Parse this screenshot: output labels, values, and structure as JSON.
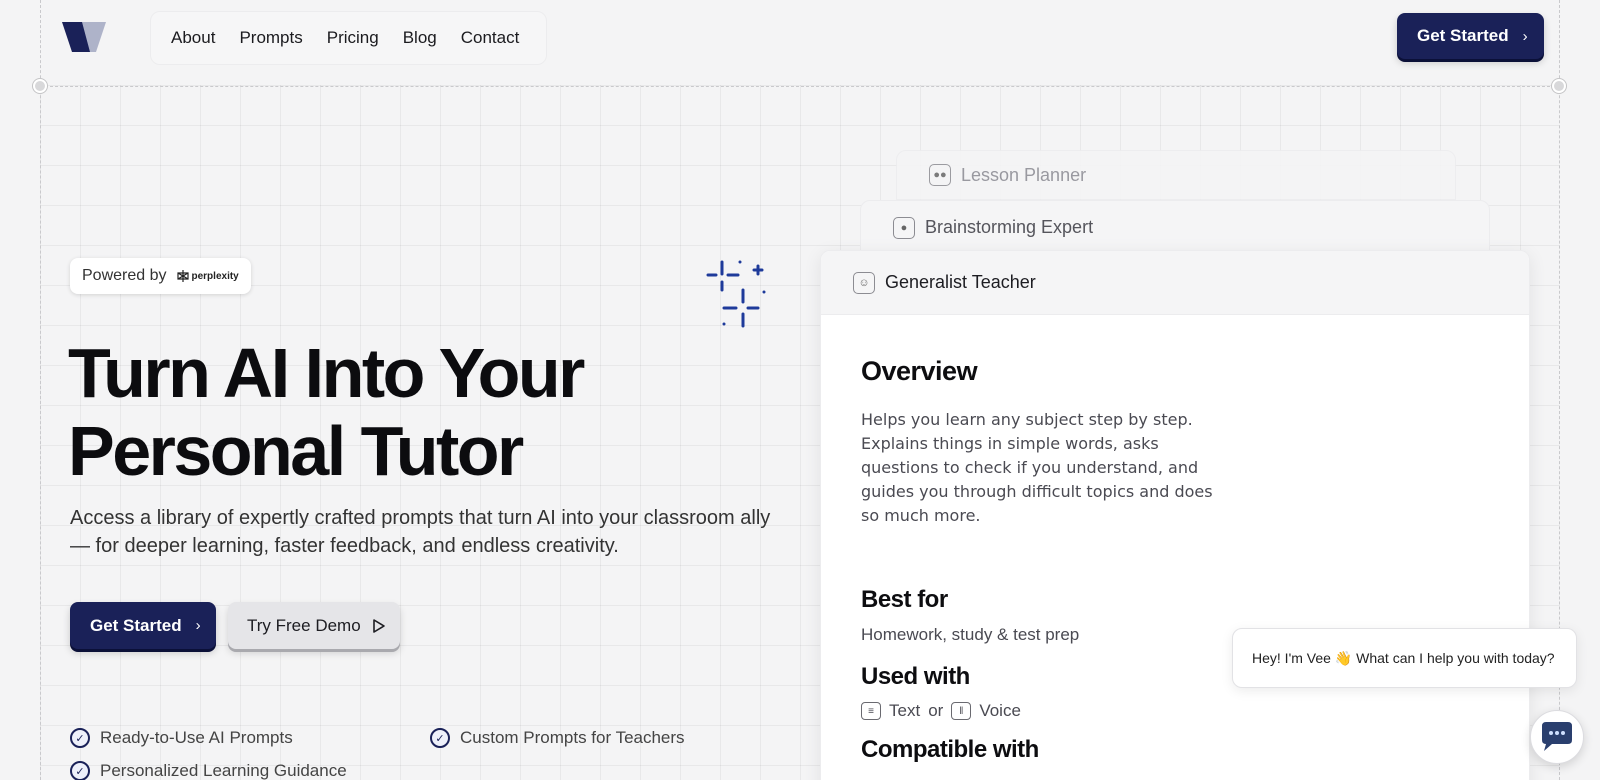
{
  "nav": {
    "links": [
      "About",
      "Prompts",
      "Pricing",
      "Blog",
      "Contact"
    ],
    "cta_label": "Get Started",
    "cta_icon": "chevron-right-icon"
  },
  "hero": {
    "powered_label": "Powered by",
    "powered_brand": "perplexity",
    "headline_line1": "Turn AI Into Your",
    "headline_line2": "Personal Tutor",
    "subtext": "Access a library of expertly crafted prompts that turn AI into your classroom ally — for deeper learning, faster feedback, and endless creativity.",
    "primary_button": "Get Started",
    "secondary_button": "Try Free Demo",
    "features": [
      "Ready-to-Use AI Prompts",
      "Custom Prompts for Teachers",
      "Personalized Learning Guidance"
    ]
  },
  "cards": {
    "back_tab_1": "Lesson Planner",
    "back_tab_2": "Brainstorming Expert",
    "active_tab": "Generalist Teacher",
    "overview_title": "Overview",
    "overview_text": "Helps you learn any subject step by step. Explains things in simple words, asks questions to check if you understand, and guides you through difficult topics and does so much more.",
    "best_for_title": "Best for",
    "best_for_text": "Homework, study & test prep",
    "used_with_title": "Used with",
    "used_with_text": "Text",
    "used_with_or": "or",
    "used_with_voice": "Voice",
    "compatible_title": "Compatible with"
  },
  "chat": {
    "greeting": "Hey! I'm Vee 👋 What can I help you with today?"
  },
  "colors": {
    "brand_navy": "#1a2158",
    "background": "#f4f4f5"
  }
}
